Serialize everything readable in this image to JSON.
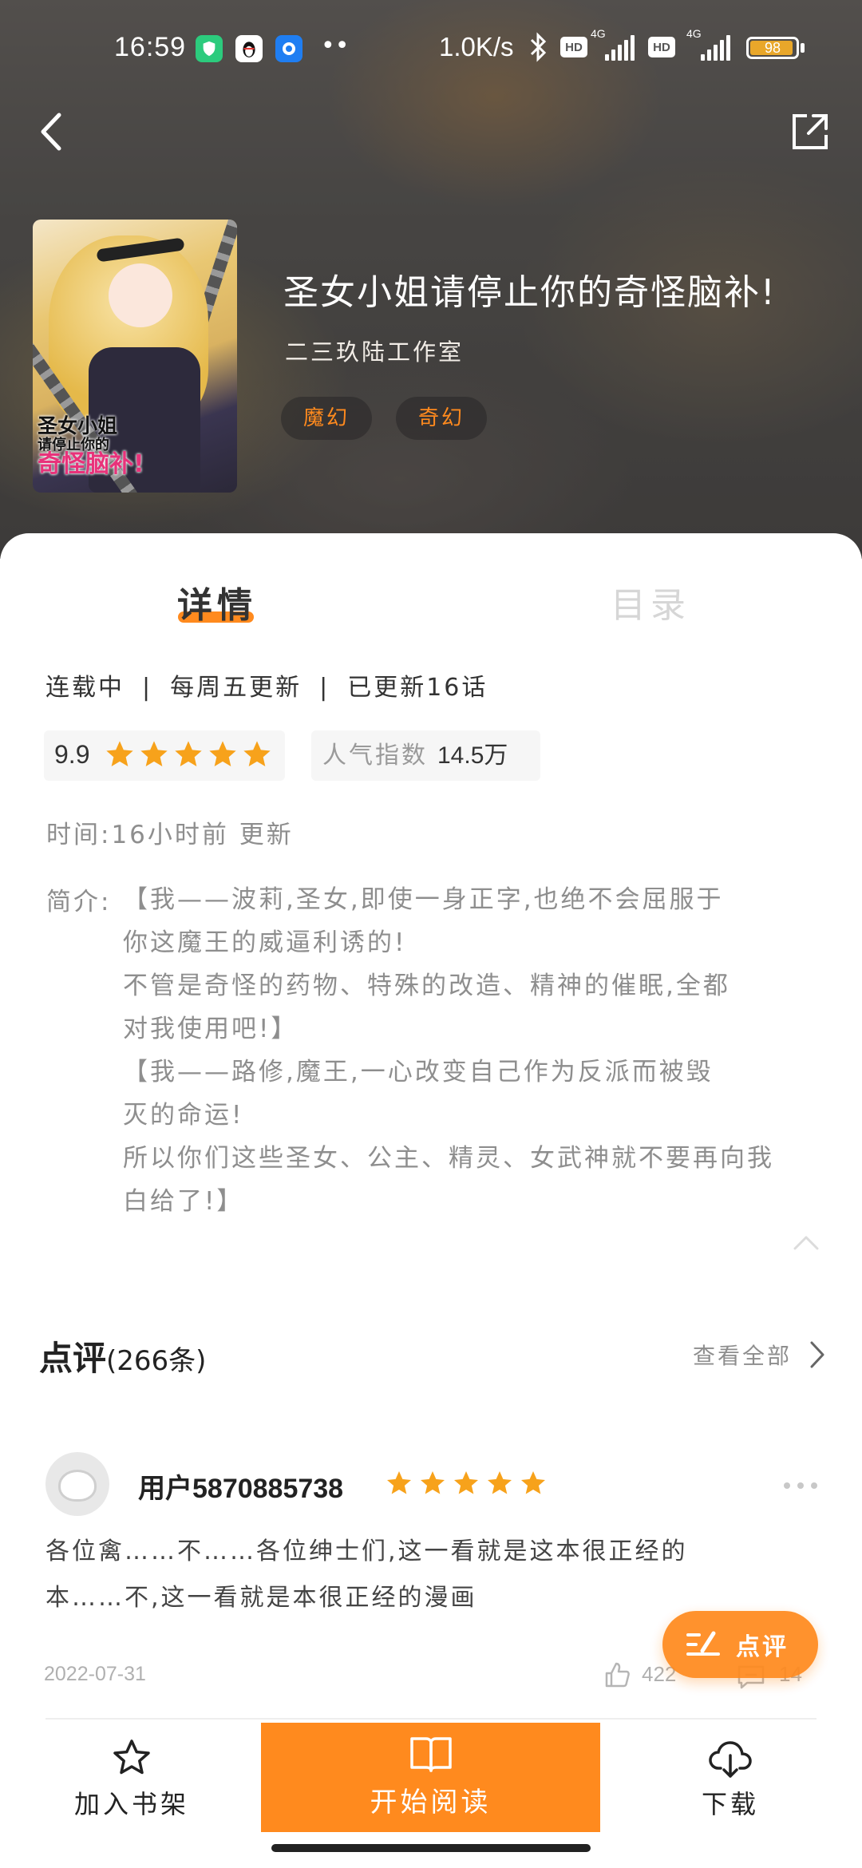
{
  "status_bar": {
    "time": "16:59",
    "net_speed": "1.0K/s",
    "hd_label": "HD",
    "network_4g": "4G",
    "battery_level": "98",
    "overflow_dots": "••"
  },
  "comic": {
    "title": "圣女小姐请停止你的奇怪脑补!",
    "author": "二三玖陆工作室",
    "tags": [
      "魔幻",
      "奇幻"
    ],
    "cover_text_line1": "圣女小姐",
    "cover_text_line2": "请停止你的",
    "cover_text_line3": "奇怪脑补!"
  },
  "tabs": {
    "details": "详情",
    "catalog": "目录"
  },
  "details": {
    "status": "连载中",
    "schedule": "每周五更新",
    "episodes": "已更新16话",
    "separator": "|",
    "score": "9.9",
    "score_stars": 5,
    "popularity_label": "人气指数",
    "popularity_value": "14.5万",
    "time_line": "时间:16小时前 更新",
    "intro_label": "简介:",
    "intro_lines": [
      "【我——波莉,圣女,即使一身正字,也绝不会屈服于",
      "你这魔王的威逼利诱的!",
      "不管是奇怪的药物、特殊的改造、精神的催眠,全都",
      "对我使用吧!】",
      "【我——路修,魔王,一心改变自己作为反派而被毁",
      "灭的命运!",
      "所以你们这些圣女、公主、精灵、女武神就不要再向我",
      "白给了!】"
    ]
  },
  "reviews": {
    "heading": "点评",
    "count": "(266条)",
    "see_all": "查看全部",
    "items": [
      {
        "username": "用户5870885738",
        "stars": 5,
        "body_lines": [
          "各位禽……不……各位绅士们,这一看就是这本很正经的",
          "本……不,这一看就是本很正经的漫画"
        ],
        "date": "2022-07-31",
        "likes": "422",
        "comments": "14"
      }
    ]
  },
  "fab": {
    "label": "点评"
  },
  "bottom_bar": {
    "add_shelf": "加入书架",
    "start_reading": "开始阅读",
    "download": "下载"
  },
  "colors": {
    "accent": "#ff8a1e",
    "star": "#f7a21b",
    "muted_text": "#8e8e8e"
  }
}
